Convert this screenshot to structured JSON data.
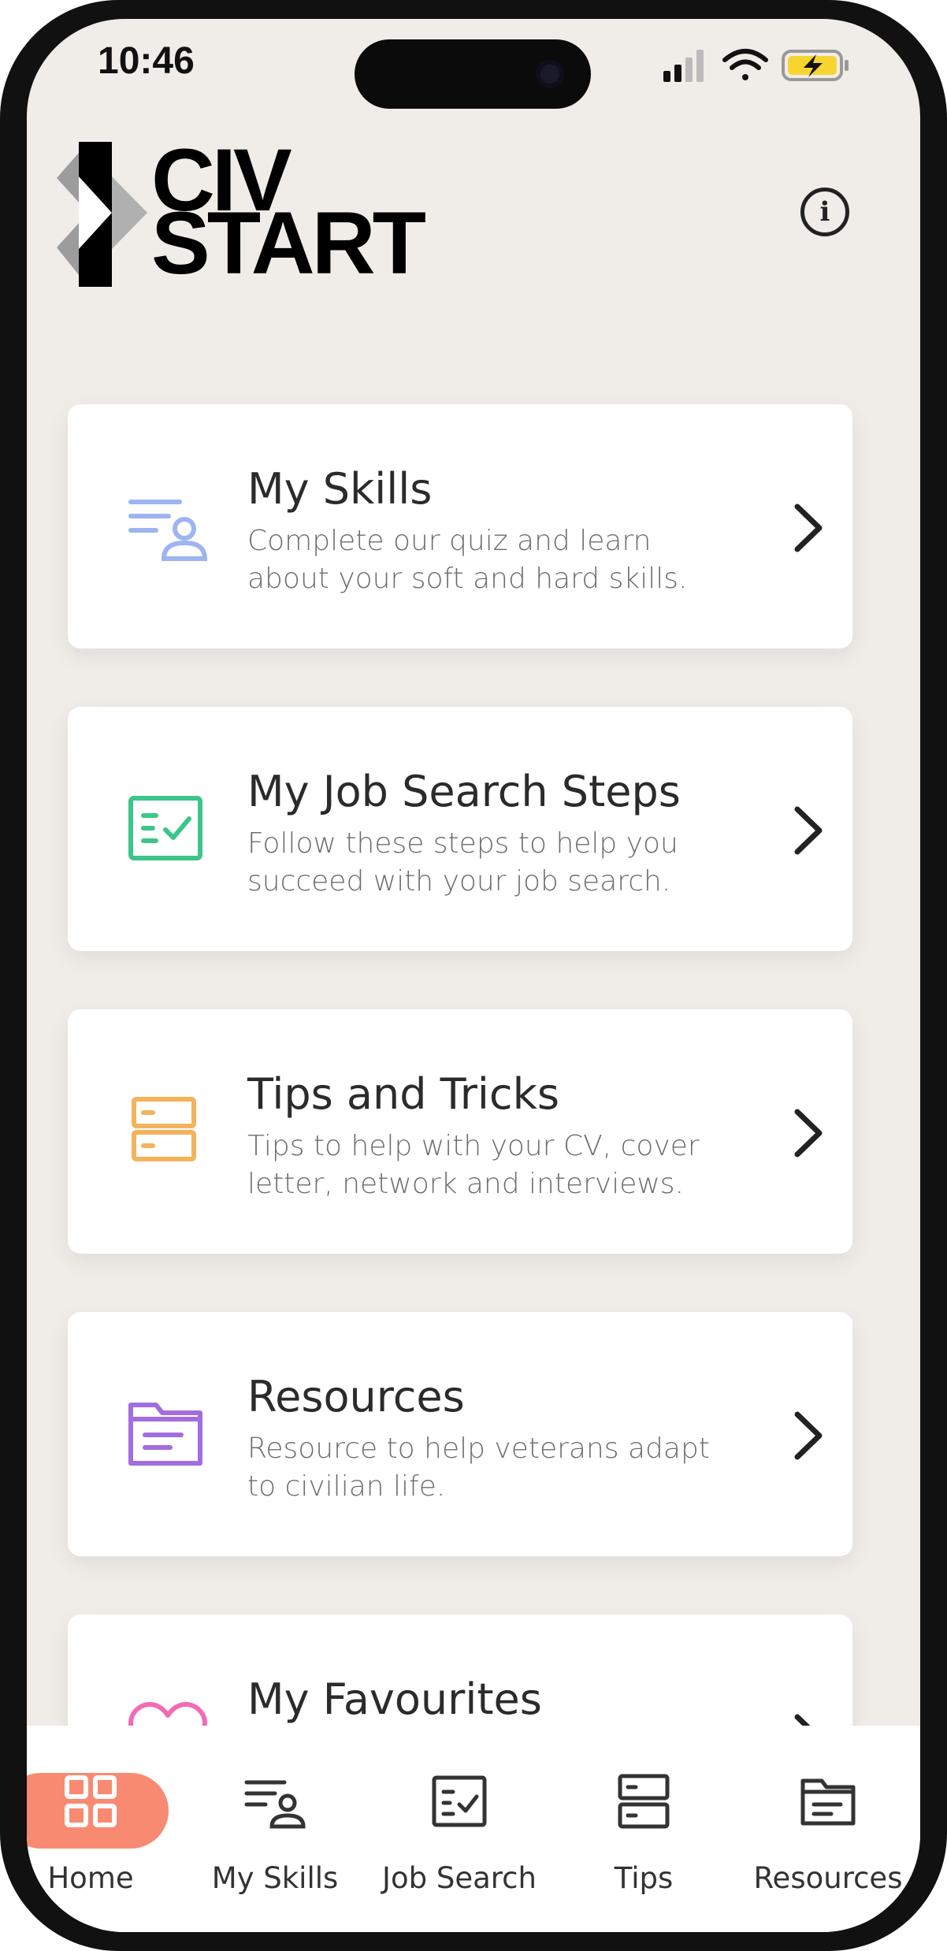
{
  "status_bar": {
    "time": "10:46"
  },
  "header": {
    "logo_line1": "CIV",
    "logo_line2": "START"
  },
  "colors": {
    "skills_icon": "#9db5f0",
    "jobsearch_icon": "#3cc68a",
    "tips_icon": "#f3b35c",
    "resources_icon": "#a36de0",
    "favourites_icon": "#f26bb5",
    "home_pill": "#f98a72",
    "battery": "#f7d531"
  },
  "cards": [
    {
      "title": "My Skills",
      "desc": "Complete our quiz and learn about your soft and hard skills.",
      "icon": "skills-icon"
    },
    {
      "title": "My Job Search Steps",
      "desc": "Follow these steps to help you succeed with your job search.",
      "icon": "checklist-icon"
    },
    {
      "title": "Tips and Tricks",
      "desc": "Tips to help with your CV, cover letter, network and interviews.",
      "icon": "server-stack-icon"
    },
    {
      "title": "Resources",
      "desc": "Resource to help veterans adapt to civilian life.",
      "icon": "folder-icon"
    },
    {
      "title": "My Favourites",
      "desc": "",
      "icon": "heart-icon"
    }
  ],
  "tabs": [
    {
      "label": "Home",
      "icon": "grid-icon"
    },
    {
      "label": "My Skills",
      "icon": "skills-icon"
    },
    {
      "label": "Job Search",
      "icon": "checklist-icon"
    },
    {
      "label": "Tips",
      "icon": "server-stack-icon"
    },
    {
      "label": "Resources",
      "icon": "folder-icon"
    }
  ]
}
